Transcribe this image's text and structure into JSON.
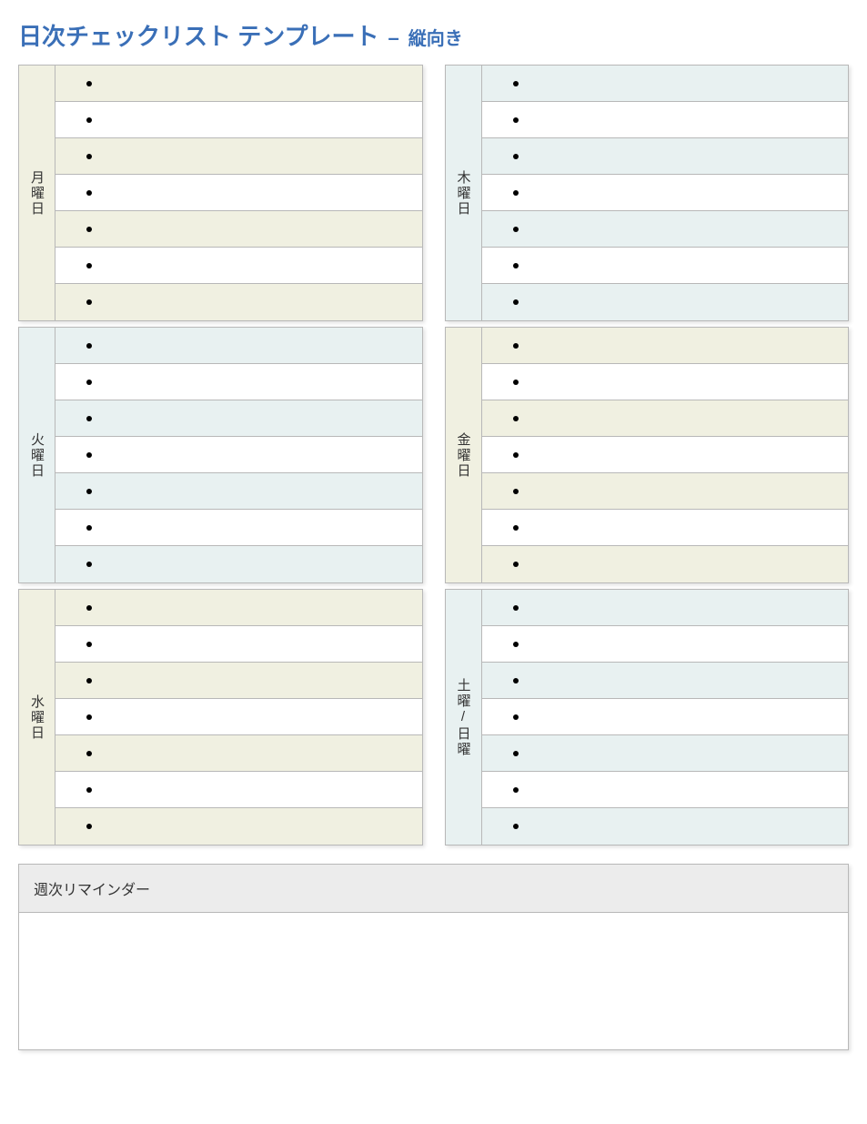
{
  "title": {
    "main": "日次チェックリスト テンプレート",
    "dash": "–",
    "sub": "縦向き"
  },
  "days": [
    {
      "id": "mon",
      "label": "月曜日",
      "tint": "beige",
      "column": 0,
      "items": [
        "",
        "",
        "",
        "",
        "",
        "",
        ""
      ]
    },
    {
      "id": "tue",
      "label": "火曜日",
      "tint": "blue",
      "column": 0,
      "items": [
        "",
        "",
        "",
        "",
        "",
        "",
        ""
      ]
    },
    {
      "id": "wed",
      "label": "水曜日",
      "tint": "beige",
      "column": 0,
      "items": [
        "",
        "",
        "",
        "",
        "",
        "",
        ""
      ]
    },
    {
      "id": "thu",
      "label": "木曜日",
      "tint": "blue",
      "column": 1,
      "items": [
        "",
        "",
        "",
        "",
        "",
        "",
        ""
      ]
    },
    {
      "id": "fri",
      "label": "金曜日",
      "tint": "beige",
      "column": 1,
      "items": [
        "",
        "",
        "",
        "",
        "",
        "",
        ""
      ]
    },
    {
      "id": "satsun",
      "label": "土曜/日曜",
      "tint": "blue",
      "column": 1,
      "items": [
        "",
        "",
        "",
        "",
        "",
        "",
        ""
      ]
    }
  ],
  "reminder": {
    "header": "週次リマインダー",
    "body": ""
  }
}
